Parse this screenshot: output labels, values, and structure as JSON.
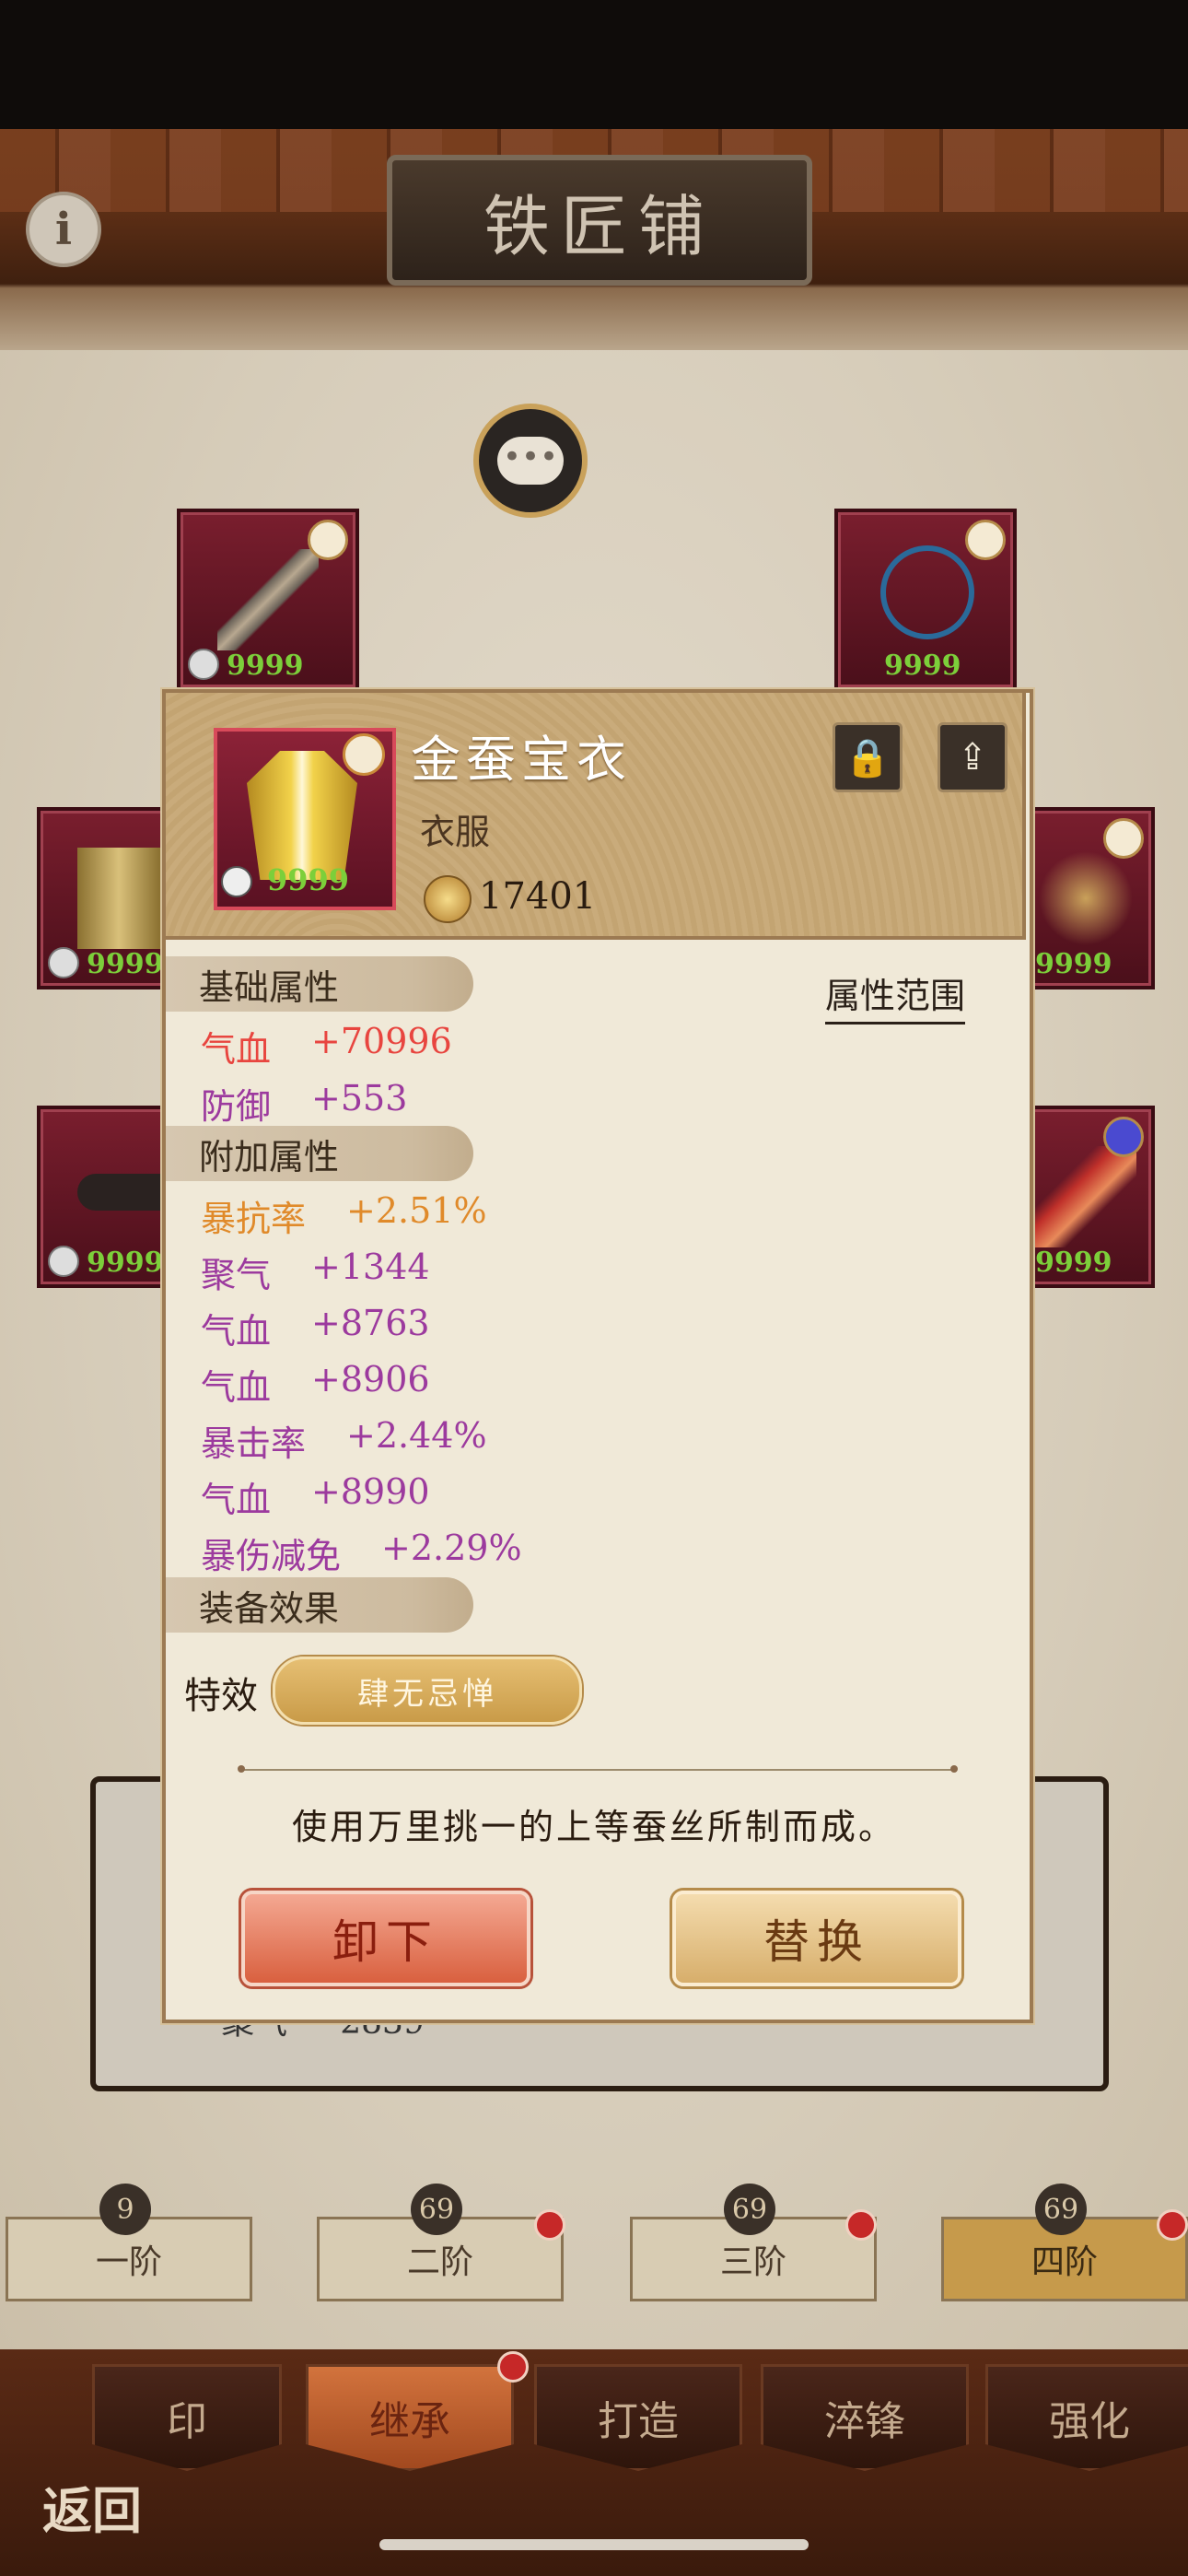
{
  "header": {
    "title": "铁匠铺",
    "info_icon": "info-icon"
  },
  "slots": [
    {
      "level": "9999"
    },
    {
      "level": "9999"
    },
    {
      "level": "9999"
    },
    {
      "level": "9999"
    },
    {
      "level": "9999"
    },
    {
      "level": "9999"
    }
  ],
  "item": {
    "name": "金蚕宝衣",
    "type": "衣服",
    "power": "17401",
    "level": "9999"
  },
  "base_attrs": {
    "title": "基础属性",
    "range_link": "属性范围",
    "rows": [
      {
        "name": "气血",
        "value": "+70996",
        "color": "#e8453f"
      },
      {
        "name": "防御",
        "value": "+553",
        "color": "#9c3a9e"
      }
    ]
  },
  "extra_attrs": {
    "title": "附加属性",
    "rows": [
      {
        "name": "暴抗率",
        "value": "+2.51%",
        "color": "#e08a2a"
      },
      {
        "name": "聚气",
        "value": "+1344",
        "color": "#9c3a9e"
      },
      {
        "name": "气血",
        "value": "+8763",
        "color": "#9c3a9e"
      },
      {
        "name": "气血",
        "value": "+8906",
        "color": "#9c3a9e"
      },
      {
        "name": "暴击率",
        "value": "+2.44%",
        "color": "#9c3a9e"
      },
      {
        "name": "气血",
        "value": "+8990",
        "color": "#9c3a9e"
      },
      {
        "name": "暴伤减免",
        "value": "+2.29%",
        "color": "#9c3a9e"
      }
    ]
  },
  "effects": {
    "title": "装备效果",
    "special_label": "特效",
    "special_value": "肆无忌惮"
  },
  "description": "使用万里挑一的上等蚕丝所制而成。",
  "buttons": {
    "unequip": "卸下",
    "replace": "替换"
  },
  "under_panel": {
    "label": "聚气",
    "value": "2839"
  },
  "tiers": [
    {
      "label": "一阶",
      "icon": "9"
    },
    {
      "label": "二阶",
      "icon": "69"
    },
    {
      "label": "三阶",
      "icon": "69"
    },
    {
      "label": "四阶",
      "icon": "69"
    }
  ],
  "nav": {
    "tabs": [
      "印",
      "继承",
      "打造",
      "淬锋",
      "强化"
    ],
    "back": "返回"
  }
}
